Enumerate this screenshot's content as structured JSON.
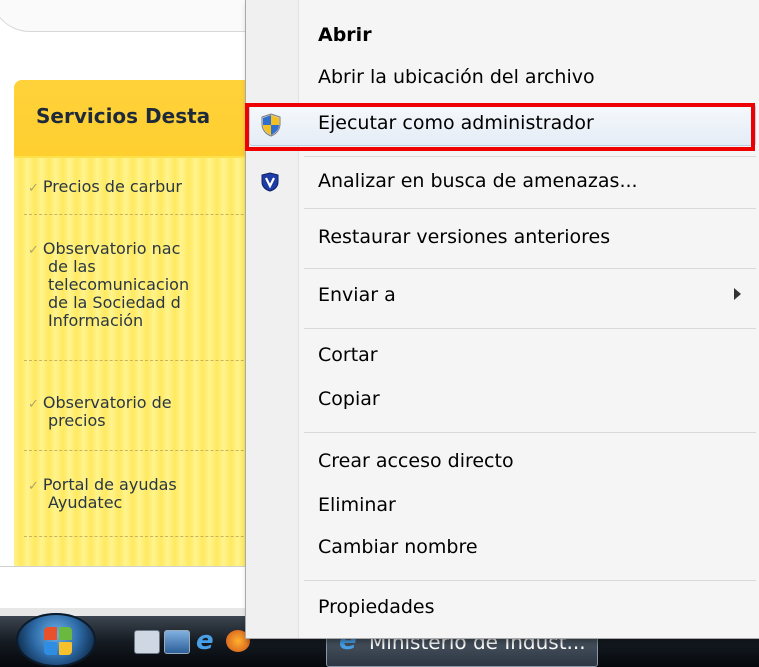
{
  "page": {
    "panel_title": "Servicios Desta",
    "items": [
      "Precios de carbur",
      "Observatorio nac",
      "de las",
      "telecomunicacion",
      "de la Sociedad d",
      "Información",
      "Observatorio de",
      "precios",
      "Portal de ayudas",
      "Ayudatec"
    ]
  },
  "context_menu": {
    "items": [
      {
        "label": "Abrir",
        "bold": true
      },
      {
        "label": "Abrir la ubicación del archivo"
      },
      {
        "label": "Ejecutar como administrador",
        "icon": "uac-shield-icon",
        "highlighted": true
      },
      {
        "label": "Analizar en busca de amenazas...",
        "icon": "antivirus-shield-icon"
      },
      {
        "label": "Restaurar versiones anteriores"
      },
      {
        "label": "Enviar a",
        "submenu": true
      },
      {
        "label": "Cortar"
      },
      {
        "label": "Copiar"
      },
      {
        "label": "Crear acceso directo"
      },
      {
        "label": "Eliminar"
      },
      {
        "label": "Cambiar nombre"
      },
      {
        "label": "Propiedades"
      }
    ]
  },
  "taskbar": {
    "task_button_label": "Ministerio de Indust..."
  },
  "colors": {
    "highlight_box": "#ee0000",
    "panel_yellow": "#ffe24a"
  }
}
